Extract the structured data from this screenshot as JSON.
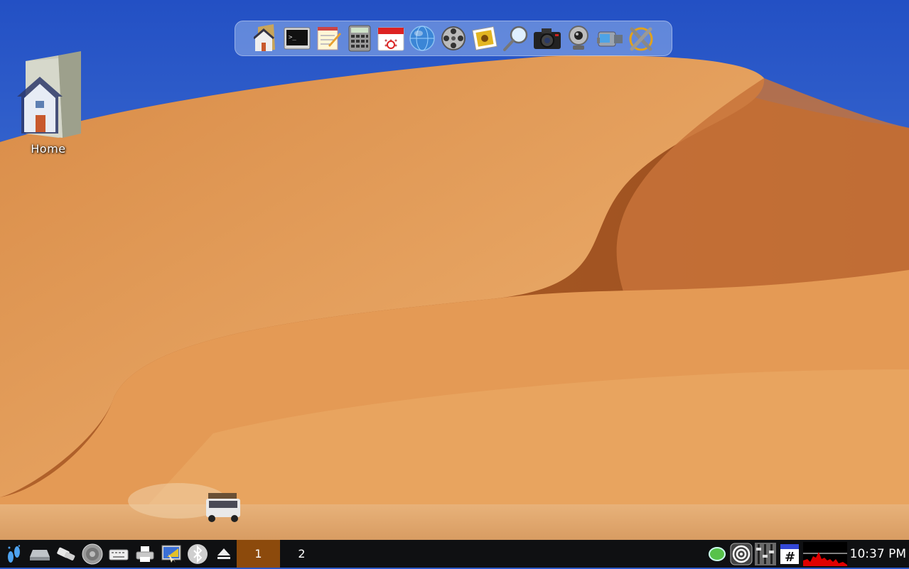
{
  "desktop": {
    "home_icon": {
      "label": "Home",
      "icon": "home-folder-icon"
    }
  },
  "dock": {
    "items": [
      {
        "name": "file-manager",
        "icon": "home-folder-icon"
      },
      {
        "name": "terminal",
        "icon": "terminal-icon"
      },
      {
        "name": "text-editor",
        "icon": "notepad-icon"
      },
      {
        "name": "calculator",
        "icon": "calculator-icon"
      },
      {
        "name": "calendar",
        "icon": "calendar-icon"
      },
      {
        "name": "web-browser",
        "icon": "globe-icon"
      },
      {
        "name": "video-player",
        "icon": "film-reel-icon"
      },
      {
        "name": "image-viewer",
        "icon": "photo-icon"
      },
      {
        "name": "search",
        "icon": "magnifier-icon"
      },
      {
        "name": "camera",
        "icon": "camera-icon"
      },
      {
        "name": "webcam",
        "icon": "webcam-icon"
      },
      {
        "name": "video-camera",
        "icon": "camcorder-icon"
      },
      {
        "name": "settings-tools",
        "icon": "tools-icon"
      }
    ]
  },
  "taskbar": {
    "launchers": [
      {
        "name": "start-menu",
        "icon": "foot-icon"
      },
      {
        "name": "drive",
        "icon": "drive-icon"
      },
      {
        "name": "network",
        "icon": "network-cable-icon"
      },
      {
        "name": "volume",
        "icon": "speaker-icon"
      },
      {
        "name": "keyboard",
        "icon": "keyboard-icon"
      },
      {
        "name": "printer",
        "icon": "printer-icon"
      },
      {
        "name": "display",
        "icon": "display-settings-icon"
      },
      {
        "name": "bluetooth",
        "icon": "bluetooth-icon"
      },
      {
        "name": "eject",
        "icon": "eject-icon"
      }
    ],
    "workspaces": [
      {
        "label": "1",
        "active": true
      },
      {
        "label": "2",
        "active": false
      }
    ],
    "tray": [
      {
        "name": "chat",
        "icon": "chat-bubble-icon"
      },
      {
        "name": "wireless",
        "icon": "wireless-icon"
      },
      {
        "name": "mixer",
        "icon": "mixer-sliders-icon"
      },
      {
        "name": "calculator-tray",
        "icon": "hash-icon"
      }
    ],
    "cpu_monitor": {
      "icon": "cpu-graph-icon",
      "color": "#e00000"
    },
    "clock": "10:37 PM"
  },
  "colors": {
    "active_workspace": "#8c4a0c",
    "taskbar": "#0f1012"
  }
}
